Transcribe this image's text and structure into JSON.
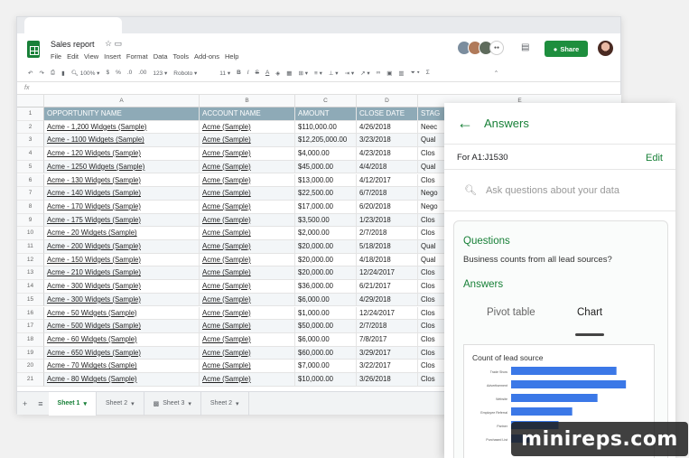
{
  "doc": {
    "title": "Sales report",
    "menu": [
      "File",
      "Edit",
      "View",
      "Insert",
      "Format",
      "Data",
      "Tools",
      "Add-ons",
      "Help"
    ],
    "share_label": "Share"
  },
  "toolbar": {
    "zoom": "100%",
    "currency": "$",
    "percent": "%",
    "dec1": ".0",
    "dec2": ".00",
    "number_format": "123",
    "font": "Roboto",
    "font_size": "11"
  },
  "formula_bar": {
    "fx": "fx"
  },
  "columns": [
    "A",
    "B",
    "C",
    "D",
    "E"
  ],
  "rows": [
    [
      "OPPORTUNITY NAME",
      "ACCOUNT NAME",
      "AMOUNT",
      "CLOSE DATE",
      "STAG"
    ],
    [
      "Acme - 1,200 Widgets (Sample)",
      "Acme (Sample)",
      "$110,000.00",
      "4/26/2018",
      "Neec"
    ],
    [
      "Acme - 1100 Widgets (Sample)",
      "Acme (Sample)",
      "$12,205,000.00",
      "3/23/2018",
      "Qual"
    ],
    [
      "Acme - 120 Widgets (Sample)",
      "Acme (Sample)",
      "$4,000.00",
      "4/23/2018",
      "Clos"
    ],
    [
      "Acme - 1250 Widgets (Sample)",
      "Acme (Sample)",
      "$45,000.00",
      "4/4/2018",
      "Qual"
    ],
    [
      "Acme - 130 Widgets (Sample)",
      "Acme (Sample)",
      "$13,000.00",
      "4/12/2017",
      "Clos"
    ],
    [
      "Acme - 140 Widgets (Sample)",
      "Acme (Sample)",
      "$22,500.00",
      "6/7/2018",
      "Nego"
    ],
    [
      "Acme - 170 Widgets (Sample)",
      "Acme (Sample)",
      "$17,000.00",
      "6/20/2018",
      "Nego"
    ],
    [
      "Acme - 175 Widgets (Sample)",
      "Acme (Sample)",
      "$3,500.00",
      "1/23/2018",
      "Clos"
    ],
    [
      "Acme - 20 Widgets (Sample)",
      "Acme (Sample)",
      "$2,000.00",
      "2/7/2018",
      "Clos"
    ],
    [
      "Acme - 200 Widgets (Sample)",
      "Acme (Sample)",
      "$20,000.00",
      "5/18/2018",
      "Qual"
    ],
    [
      "Acme - 150 Widgets (Sample)",
      "Acme (Sample)",
      "$20,000.00",
      "4/18/2018",
      "Qual"
    ],
    [
      "Acme - 210 Widgets (Sample)",
      "Acme (Sample)",
      "$20,000.00",
      "12/24/2017",
      "Clos"
    ],
    [
      "Acme - 300 Widgets (Sample)",
      "Acme (Sample)",
      "$36,000.00",
      "6/21/2017",
      "Clos"
    ],
    [
      "Acme - 300 Widgets (Sample)",
      "Acme (Sample)",
      "$6,000.00",
      "4/29/2018",
      "Clos"
    ],
    [
      "Acme - 50 Widgets (Sample)",
      "Acme (Sample)",
      "$1,000.00",
      "12/24/2017",
      "Clos"
    ],
    [
      "Acme - 500 Widgets (Sample)",
      "Acme (Sample)",
      "$50,000.00",
      "2/7/2018",
      "Clos"
    ],
    [
      "Acme - 60 Widgets (Sample)",
      "Acme (Sample)",
      "$6,000.00",
      "7/8/2017",
      "Clos"
    ],
    [
      "Acme - 650 Widgets (Sample)",
      "Acme (Sample)",
      "$60,000.00",
      "3/29/2017",
      "Clos"
    ],
    [
      "Acme - 70 Widgets (Sample)",
      "Acme (Sample)",
      "$7,000.00",
      "3/22/2017",
      "Clos"
    ],
    [
      "Acme - 80 Widgets (Sample)",
      "Acme (Sample)",
      "$10,000.00",
      "3/26/2018",
      "Clos"
    ]
  ],
  "sheets": [
    "Sheet 1",
    "Sheet 2",
    "Sheet 3",
    "Sheet 2"
  ],
  "panel": {
    "title": "Answers",
    "range": "For A1:J1530",
    "edit": "Edit",
    "ask_placeholder": "Ask questions about your data",
    "questions_heading": "Questions",
    "question": "Business counts from all lead sources?",
    "answers_heading": "Answers",
    "tab_pivot": "Pivot table",
    "tab_chart": "Chart",
    "chart_title": "Count of lead source"
  },
  "chart_data": {
    "type": "bar",
    "title": "Count of lead source",
    "categories": [
      "Trade Show",
      "Advertisement",
      "Website",
      "Employee Referral",
      "Partner",
      "Purchased List"
    ],
    "values": [
      100,
      109,
      82,
      58,
      45,
      20
    ],
    "xlim": [
      0,
      120
    ],
    "color": "#3b78e7"
  },
  "watermark": "minireps.com",
  "colors": {
    "accent": "#188038",
    "header_fill": "#8eaab7",
    "share": "#1e8e3e"
  }
}
